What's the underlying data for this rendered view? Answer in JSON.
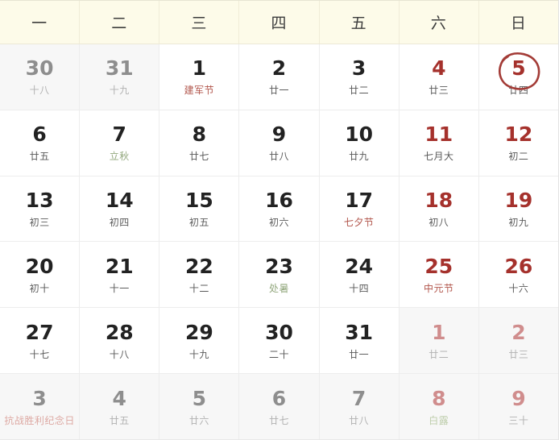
{
  "header": {
    "weekdays": [
      "一",
      "二",
      "三",
      "四",
      "五",
      "六",
      "日"
    ]
  },
  "colors": {
    "header_bg": "#fdfbe9",
    "cell_bg": "#ffffff",
    "other_month_bg": "#f7f7f7",
    "weekday_text": "#3d3d3d",
    "number": "#222222",
    "weekend_number": "#a5312c",
    "muted_number": "#8e8e8e",
    "muted_red_number": "#d08d8d",
    "lunar_text": "#5b5b5b",
    "festival_text": "#b2564c",
    "solar_term_text": "#93a87e",
    "grid_line": "#ededed",
    "highlight_circle": "#a33b36"
  },
  "highlight": {
    "day": "5",
    "icon": "hand-drawn-circle-annotation"
  },
  "weeks": [
    [
      {
        "num": "30",
        "sub": "十八",
        "num_style": "muted",
        "sub_style": "muted",
        "other": true,
        "marked": false
      },
      {
        "num": "31",
        "sub": "十九",
        "num_style": "muted",
        "sub_style": "muted",
        "other": true,
        "marked": false
      },
      {
        "num": "1",
        "sub": "建军节",
        "num_style": "normal",
        "sub_style": "festival",
        "other": false,
        "marked": false
      },
      {
        "num": "2",
        "sub": "廿一",
        "num_style": "normal",
        "sub_style": "normal",
        "other": false,
        "marked": false
      },
      {
        "num": "3",
        "sub": "廿二",
        "num_style": "normal",
        "sub_style": "normal",
        "other": false,
        "marked": false
      },
      {
        "num": "4",
        "sub": "廿三",
        "num_style": "weekend",
        "sub_style": "normal",
        "other": false,
        "marked": false
      },
      {
        "num": "5",
        "sub": "廿四",
        "num_style": "weekend",
        "sub_style": "normal",
        "other": false,
        "marked": true
      }
    ],
    [
      {
        "num": "6",
        "sub": "廿五",
        "num_style": "normal",
        "sub_style": "normal",
        "other": false,
        "marked": false
      },
      {
        "num": "7",
        "sub": "立秋",
        "num_style": "normal",
        "sub_style": "solar",
        "other": false,
        "marked": false
      },
      {
        "num": "8",
        "sub": "廿七",
        "num_style": "normal",
        "sub_style": "normal",
        "other": false,
        "marked": false
      },
      {
        "num": "9",
        "sub": "廿八",
        "num_style": "normal",
        "sub_style": "normal",
        "other": false,
        "marked": false
      },
      {
        "num": "10",
        "sub": "廿九",
        "num_style": "normal",
        "sub_style": "normal",
        "other": false,
        "marked": false
      },
      {
        "num": "11",
        "sub": "七月大",
        "num_style": "weekend",
        "sub_style": "normal",
        "other": false,
        "marked": false
      },
      {
        "num": "12",
        "sub": "初二",
        "num_style": "weekend",
        "sub_style": "normal",
        "other": false,
        "marked": false
      }
    ],
    [
      {
        "num": "13",
        "sub": "初三",
        "num_style": "normal",
        "sub_style": "normal",
        "other": false,
        "marked": false
      },
      {
        "num": "14",
        "sub": "初四",
        "num_style": "normal",
        "sub_style": "normal",
        "other": false,
        "marked": false
      },
      {
        "num": "15",
        "sub": "初五",
        "num_style": "normal",
        "sub_style": "normal",
        "other": false,
        "marked": false
      },
      {
        "num": "16",
        "sub": "初六",
        "num_style": "normal",
        "sub_style": "normal",
        "other": false,
        "marked": false
      },
      {
        "num": "17",
        "sub": "七夕节",
        "num_style": "normal",
        "sub_style": "festival",
        "other": false,
        "marked": false
      },
      {
        "num": "18",
        "sub": "初八",
        "num_style": "weekend",
        "sub_style": "normal",
        "other": false,
        "marked": false
      },
      {
        "num": "19",
        "sub": "初九",
        "num_style": "weekend",
        "sub_style": "normal",
        "other": false,
        "marked": false
      }
    ],
    [
      {
        "num": "20",
        "sub": "初十",
        "num_style": "normal",
        "sub_style": "normal",
        "other": false,
        "marked": false
      },
      {
        "num": "21",
        "sub": "十一",
        "num_style": "normal",
        "sub_style": "normal",
        "other": false,
        "marked": false
      },
      {
        "num": "22",
        "sub": "十二",
        "num_style": "normal",
        "sub_style": "normal",
        "other": false,
        "marked": false
      },
      {
        "num": "23",
        "sub": "处暑",
        "num_style": "normal",
        "sub_style": "solar",
        "other": false,
        "marked": false
      },
      {
        "num": "24",
        "sub": "十四",
        "num_style": "normal",
        "sub_style": "normal",
        "other": false,
        "marked": false
      },
      {
        "num": "25",
        "sub": "中元节",
        "num_style": "weekend",
        "sub_style": "festival",
        "other": false,
        "marked": false
      },
      {
        "num": "26",
        "sub": "十六",
        "num_style": "weekend",
        "sub_style": "normal",
        "other": false,
        "marked": false
      }
    ],
    [
      {
        "num": "27",
        "sub": "十七",
        "num_style": "normal",
        "sub_style": "normal",
        "other": false,
        "marked": false
      },
      {
        "num": "28",
        "sub": "十八",
        "num_style": "normal",
        "sub_style": "normal",
        "other": false,
        "marked": false
      },
      {
        "num": "29",
        "sub": "十九",
        "num_style": "normal",
        "sub_style": "normal",
        "other": false,
        "marked": false
      },
      {
        "num": "30",
        "sub": "二十",
        "num_style": "normal",
        "sub_style": "normal",
        "other": false,
        "marked": false
      },
      {
        "num": "31",
        "sub": "廿一",
        "num_style": "normal",
        "sub_style": "normal",
        "other": false,
        "marked": false
      },
      {
        "num": "1",
        "sub": "廿二",
        "num_style": "muted-red",
        "sub_style": "muted",
        "other": true,
        "marked": false
      },
      {
        "num": "2",
        "sub": "廿三",
        "num_style": "muted-red",
        "sub_style": "muted",
        "other": true,
        "marked": false
      }
    ],
    [
      {
        "num": "3",
        "sub": "抗战胜利纪念日",
        "num_style": "muted",
        "sub_style": "muted-festival",
        "other": true,
        "marked": false
      },
      {
        "num": "4",
        "sub": "廿五",
        "num_style": "muted",
        "sub_style": "muted",
        "other": true,
        "marked": false
      },
      {
        "num": "5",
        "sub": "廿六",
        "num_style": "muted",
        "sub_style": "muted",
        "other": true,
        "marked": false
      },
      {
        "num": "6",
        "sub": "廿七",
        "num_style": "muted",
        "sub_style": "muted",
        "other": true,
        "marked": false
      },
      {
        "num": "7",
        "sub": "廿八",
        "num_style": "muted",
        "sub_style": "muted",
        "other": true,
        "marked": false
      },
      {
        "num": "8",
        "sub": "白露",
        "num_style": "muted-red",
        "sub_style": "muted-solar",
        "other": true,
        "marked": false
      },
      {
        "num": "9",
        "sub": "三十",
        "num_style": "muted-red",
        "sub_style": "muted",
        "other": true,
        "marked": false
      }
    ]
  ]
}
